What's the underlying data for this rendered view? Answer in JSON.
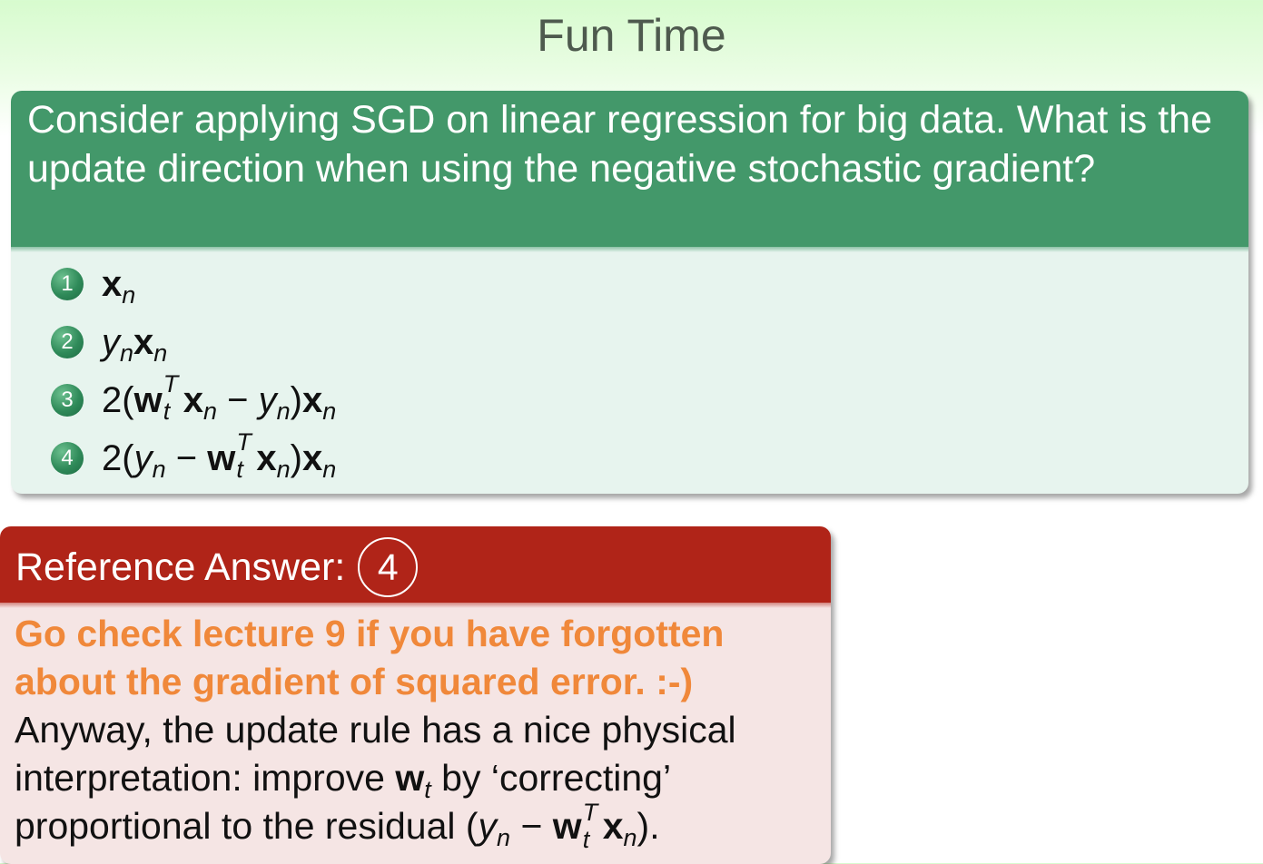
{
  "slide": {
    "title": "Fun Time"
  },
  "question": {
    "text": "Consider applying SGD on linear regression for big data. What is the update direction when using the negative stochastic gradient?",
    "options": [
      {
        "number": "1"
      },
      {
        "number": "2"
      },
      {
        "number": "3"
      },
      {
        "number": "4"
      }
    ]
  },
  "answer": {
    "heading": "Reference Answer:",
    "value": "4",
    "highlight": "Go check lecture 9 if you have forgotten about the gradient of squared error. :-)",
    "explanation_part1": "Anyway, the update rule has a nice physical interpretation: improve",
    "explanation_part2": "by ‘correcting’ proportional to the residual",
    "explanation_end": "."
  },
  "colors": {
    "question_header": "#43986a",
    "question_body": "#e7f4ee",
    "answer_header": "#b02418",
    "answer_body": "#f5e5e4",
    "highlight_text": "#f0883a",
    "title_text": "#4e5a4e"
  }
}
